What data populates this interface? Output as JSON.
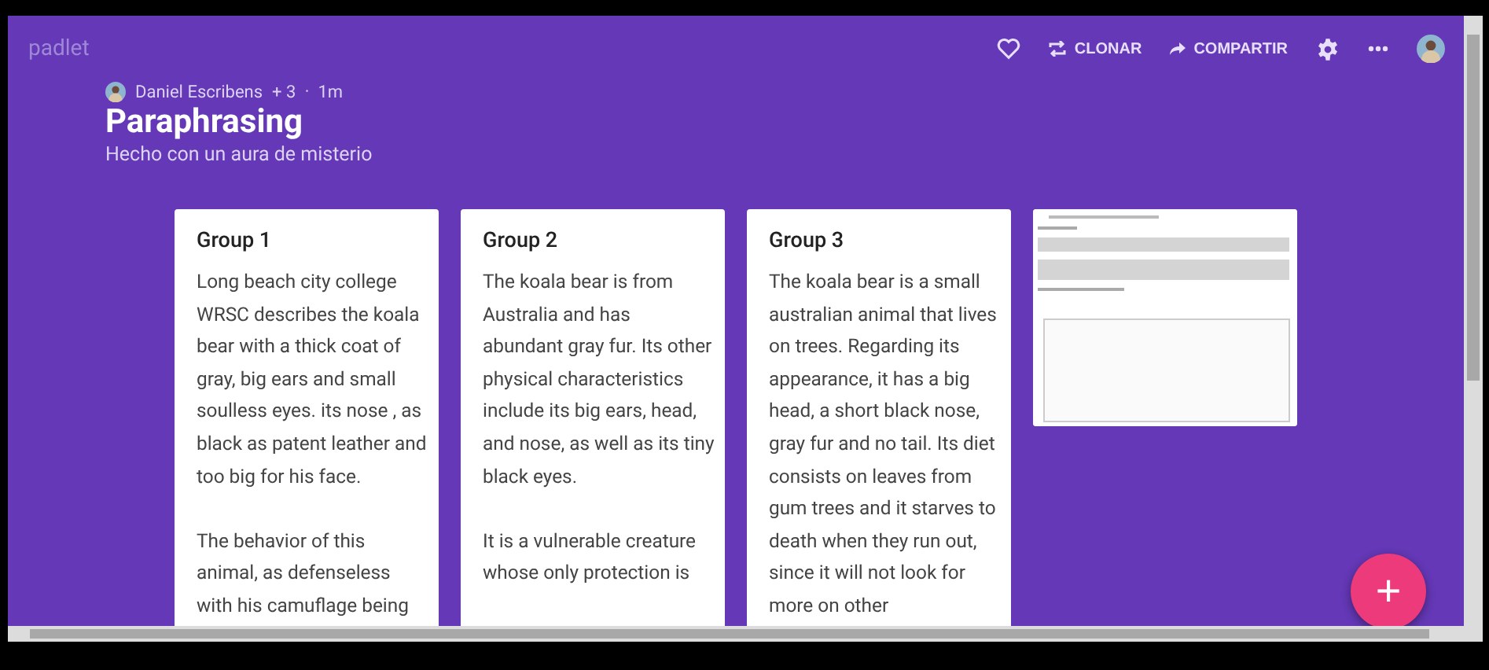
{
  "logo": "padlet",
  "toolbar": [
    {
      "kind": "heart"
    },
    {
      "kind": "clone",
      "label": "CLONAR"
    },
    {
      "kind": "share",
      "label": "COMPARTIR"
    },
    {
      "kind": "gear"
    },
    {
      "kind": "more"
    },
    {
      "kind": "avatar"
    }
  ],
  "author": {
    "name": "Daniel Escribens",
    "contributors": "+ 3",
    "separator": "•",
    "time": "1m"
  },
  "title": "Paraphrasing",
  "subtitle": "Hecho con un aura de misterio",
  "posts": [
    {
      "kind": "text",
      "title": "Group 1",
      "paragraphs": [
        "Long beach city college WRSC describes the koala bear with a thick coat of gray, big ears and small soulless eyes. its nose , as black as patent leather and too big for his face.",
        "The behavior of this animal, as defenseless with his camuflage being"
      ]
    },
    {
      "kind": "text",
      "title": "Group 2",
      "paragraphs": [
        "The koala bear is from Australia and has abundant gray fur. Its other physical characteristics include its big ears, head, and nose, as well as its tiny black eyes.",
        "It is a vulnerable creature whose only protection is"
      ]
    },
    {
      "kind": "text",
      "title": "Group 3",
      "paragraphs": [
        "The koala bear is a small australian animal that lives on trees. Regarding its appearance, it has a big head, a short black nose, gray fur and no tail. Its diet consists on leaves from gum trees and it starves to death when they run out, since it will not look for more on other"
      ]
    },
    {
      "kind": "picture"
    }
  ],
  "fab": {
    "label": "+"
  }
}
